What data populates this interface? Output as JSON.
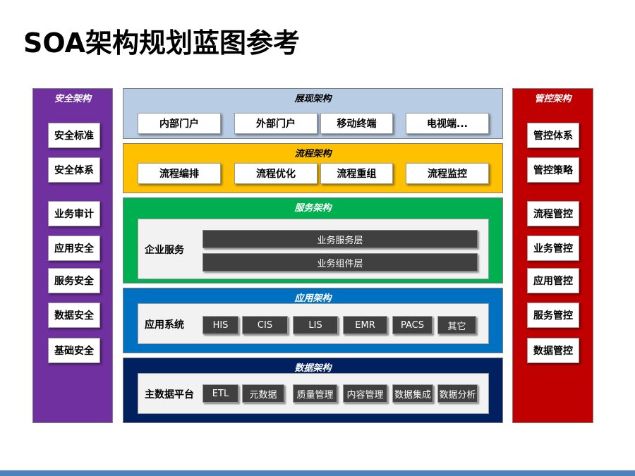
{
  "title": "SOA架构规划蓝图参考",
  "colors": {
    "security": "#7030a0",
    "presentation": "#b8cce4",
    "process": "#ffc000",
    "service": "#00b050",
    "application": "#0070c0",
    "data": "#002060",
    "governance": "#c00000",
    "chip": "#404040",
    "footer_bar": "#4f81bd"
  },
  "security": {
    "title": "安全架构",
    "items": [
      "安全标准",
      "安全体系",
      "业务审计",
      "应用安全",
      "服务安全",
      "数据安全",
      "基础安全"
    ]
  },
  "governance": {
    "title": "管控架构",
    "items": [
      "管控体系",
      "管控策略",
      "流程管控",
      "业务管控",
      "应用管控",
      "服务管控",
      "数据管控"
    ]
  },
  "presentation": {
    "title": "展现架构",
    "items": [
      "内部门户",
      "外部门户",
      "移动终端",
      "电视端..."
    ]
  },
  "process": {
    "title": "流程架构",
    "items": [
      "流程编排",
      "流程优化",
      "流程重组",
      "流程监控"
    ]
  },
  "service": {
    "title": "服务架构",
    "label": "企业服务",
    "layers": [
      "业务服务层",
      "业务组件层"
    ]
  },
  "application": {
    "title": "应用架构",
    "label": "应用系统",
    "items": [
      "HIS",
      "CIS",
      "LIS",
      "EMR",
      "PACS",
      "其它"
    ]
  },
  "data": {
    "title": "数据架构",
    "label": "主数据平台",
    "items": [
      "ETL",
      "元数据",
      "质量管理",
      "内容管理",
      "数据集成",
      "数据分析"
    ]
  }
}
